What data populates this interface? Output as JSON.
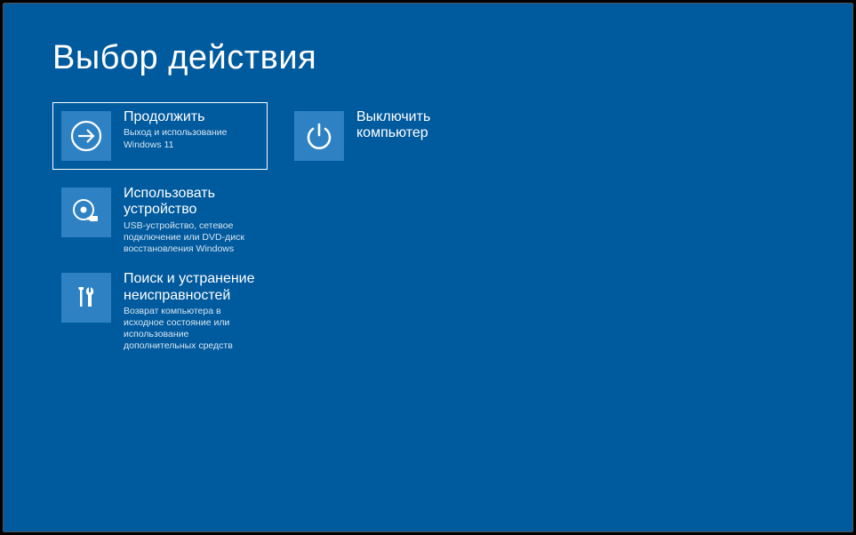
{
  "title": "Выбор действия",
  "tiles": {
    "continue": {
      "label": "Продолжить",
      "desc": "Выход и использование Windows 11"
    },
    "shutdown": {
      "label": "Выключить компьютер",
      "desc": ""
    },
    "usedevice": {
      "label": "Использовать устройство",
      "desc": "USB-устройство, сетевое подключение или DVD-диск восстановления Windows"
    },
    "troubleshoot": {
      "label": "Поиск и устранение неисправностей",
      "desc": "Возврат компьютера в исходное состояние или использование дополнительных средств"
    }
  }
}
